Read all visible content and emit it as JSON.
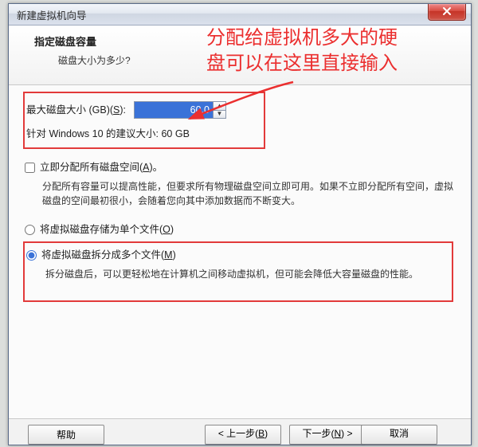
{
  "window": {
    "title": "新建虚拟机向导"
  },
  "header": {
    "title": "指定磁盘容量",
    "subtitle": "磁盘大小为多少?"
  },
  "annotation": {
    "line1": "分配给虚拟机多大的硬",
    "line2": "盘可以在这里直接输入"
  },
  "disk": {
    "size_label_pre": "最大磁盘大小 (GB)(",
    "size_hotkey": "S",
    "size_label_post": "):",
    "size_value": "60.0",
    "recommended": "针对 Windows 10 的建议大小: 60 GB"
  },
  "allocate": {
    "label_pre": "立即分配所有磁盘空间(",
    "hotkey": "A",
    "label_post": ")。",
    "desc": "分配所有容量可以提高性能，但要求所有物理磁盘空间立即可用。如果不立即分配所有空间，虚拟磁盘的空间最初很小，会随着您向其中添加数据而不断变大。"
  },
  "store_single": {
    "label_pre": "将虚拟磁盘存储为单个文件(",
    "hotkey": "O",
    "label_post": ")"
  },
  "store_split": {
    "label_pre": "将虚拟磁盘拆分成多个文件(",
    "hotkey": "M",
    "label_post": ")",
    "desc": "拆分磁盘后，可以更轻松地在计算机之间移动虚拟机，但可能会降低大容量磁盘的性能。"
  },
  "footer": {
    "help": "帮助",
    "prev_pre": "< 上一步(",
    "prev_hot": "B",
    "prev_post": ")",
    "next_pre": "下一步(",
    "next_hot": "N",
    "next_post": ") >",
    "cancel": "取消"
  },
  "colors": {
    "annotate": "#eb2f2f",
    "highlight_box": "#e23a3a"
  }
}
